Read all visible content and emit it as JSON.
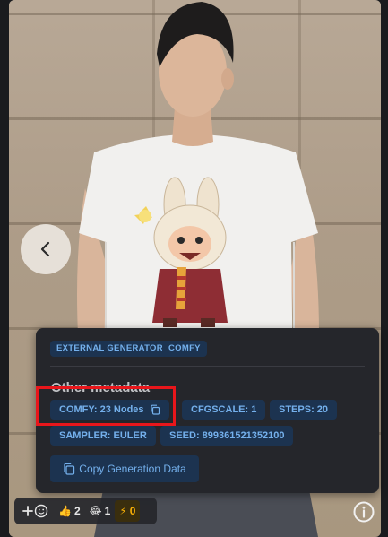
{
  "image_viewer": {
    "nav_prev_icon": "chevron-left-icon",
    "info_icon": "info-circle-icon"
  },
  "metadata_panel": {
    "tags": [
      "EXTERNAL GENERATOR",
      "COMFY"
    ],
    "section_title": "Other metadata",
    "chips": [
      {
        "label": "COMFY: 23 Nodes",
        "icon": "copy-icon"
      },
      {
        "label": "CFGSCALE: 1"
      },
      {
        "label": "STEPS: 20"
      },
      {
        "label": "SAMPLER: EULER"
      },
      {
        "label": "SEED: 899361521352100"
      }
    ],
    "copy_button_label": "Copy Generation Data"
  },
  "reactions": {
    "add_reaction_icon": "add-reaction-icon",
    "items": [
      {
        "emoji": "👍",
        "count": "2",
        "icon": "thumbs-up-icon"
      },
      {
        "emoji": "😂",
        "count": "1",
        "icon": "laughing-icon"
      },
      {
        "emoji": "⚡",
        "count": "0",
        "icon": "lightning-icon"
      }
    ]
  },
  "colors": {
    "panel_bg": "#25262b",
    "badge_bg": "#1c3350",
    "badge_text": "#74b0ec",
    "highlight": "#e8161b",
    "buzz": "#fab005"
  }
}
